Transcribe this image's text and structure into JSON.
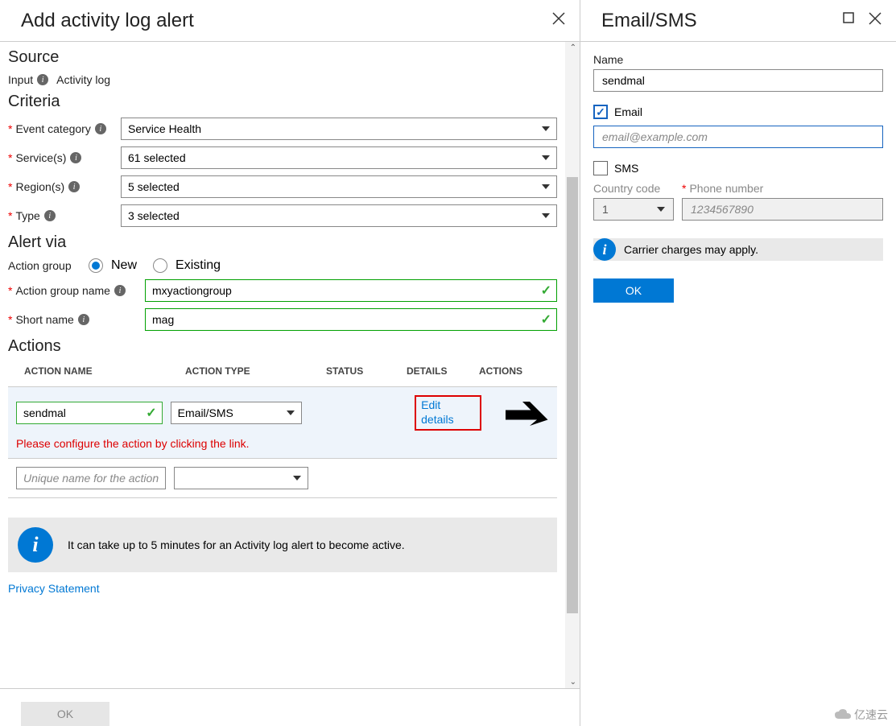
{
  "left": {
    "title": "Add activity log alert",
    "source": {
      "heading": "Source",
      "input_label": "Input",
      "input_value": "Activity log"
    },
    "criteria": {
      "heading": "Criteria",
      "event_category": {
        "label": "Event category",
        "value": "Service Health"
      },
      "services": {
        "label": "Service(s)",
        "value": "61 selected"
      },
      "regions": {
        "label": "Region(s)",
        "value": "5 selected"
      },
      "type": {
        "label": "Type",
        "value": "3 selected"
      }
    },
    "alert_via": {
      "heading": "Alert via",
      "action_group_label": "Action group",
      "new_label": "New",
      "existing_label": "Existing",
      "group_name_label": "Action group name",
      "group_name_value": "mxyactiongroup",
      "short_name_label": "Short name",
      "short_name_value": "mag"
    },
    "actions": {
      "heading": "Actions",
      "headers": {
        "name": "ACTION NAME",
        "type": "ACTION TYPE",
        "status": "STATUS",
        "details": "DETAILS",
        "actions": "ACTIONS"
      },
      "row1": {
        "name": "sendmal",
        "type": "Email/SMS",
        "edit": "Edit details",
        "error": "Please configure the action by clicking the link."
      },
      "row2": {
        "placeholder": "Unique name for the action"
      }
    },
    "info": "It can take up to 5 minutes for an Activity log alert to become active.",
    "privacy": "Privacy Statement",
    "ok": "OK"
  },
  "right": {
    "title": "Email/SMS",
    "name_label": "Name",
    "name_value": "sendmal",
    "email_label": "Email",
    "email_placeholder": "email@example.com",
    "sms_label": "SMS",
    "country_code_label": "Country code",
    "country_code_value": "1",
    "phone_label": "Phone number",
    "phone_placeholder": "1234567890",
    "carrier_msg": "Carrier charges may apply.",
    "ok": "OK"
  },
  "watermark": "亿速云"
}
